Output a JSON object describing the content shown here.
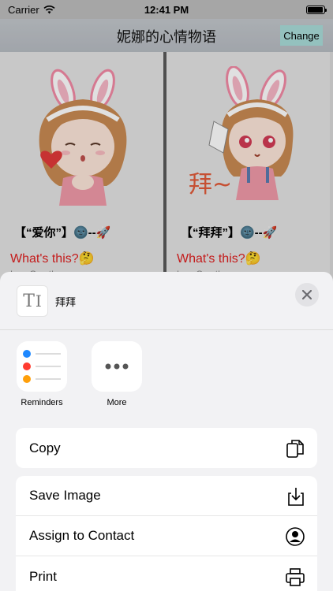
{
  "status": {
    "carrier": "Carrier",
    "time": "12:41 PM",
    "battery_level": 0.95
  },
  "nav": {
    "title": "妮娜的心情物语",
    "change_label": "Change"
  },
  "cards": [
    {
      "name": "【“爱你”】🌚--🚀",
      "question": "What's this?🤔",
      "faint": "I am Great!"
    },
    {
      "name": "【“拜拜”】🌚--🚀",
      "question": "What's this?🤔",
      "faint": "I am Great!",
      "art_text": "拜~"
    }
  ],
  "share": {
    "preview_text": "拜拜",
    "apps": [
      {
        "label": "Reminders",
        "icon": "reminders-icon"
      },
      {
        "label": "More",
        "icon": "more-icon"
      }
    ],
    "actions": [
      {
        "label": "Copy",
        "icon": "copy-icon"
      },
      {
        "label": "Save Image",
        "icon": "save-icon"
      },
      {
        "label": "Assign to Contact",
        "icon": "contact-icon"
      },
      {
        "label": "Print",
        "icon": "print-icon"
      }
    ]
  },
  "colors": {
    "question_red": "#e02020",
    "change_button": "#a9dcd9",
    "ribbon_pink": "#f38aa5"
  }
}
